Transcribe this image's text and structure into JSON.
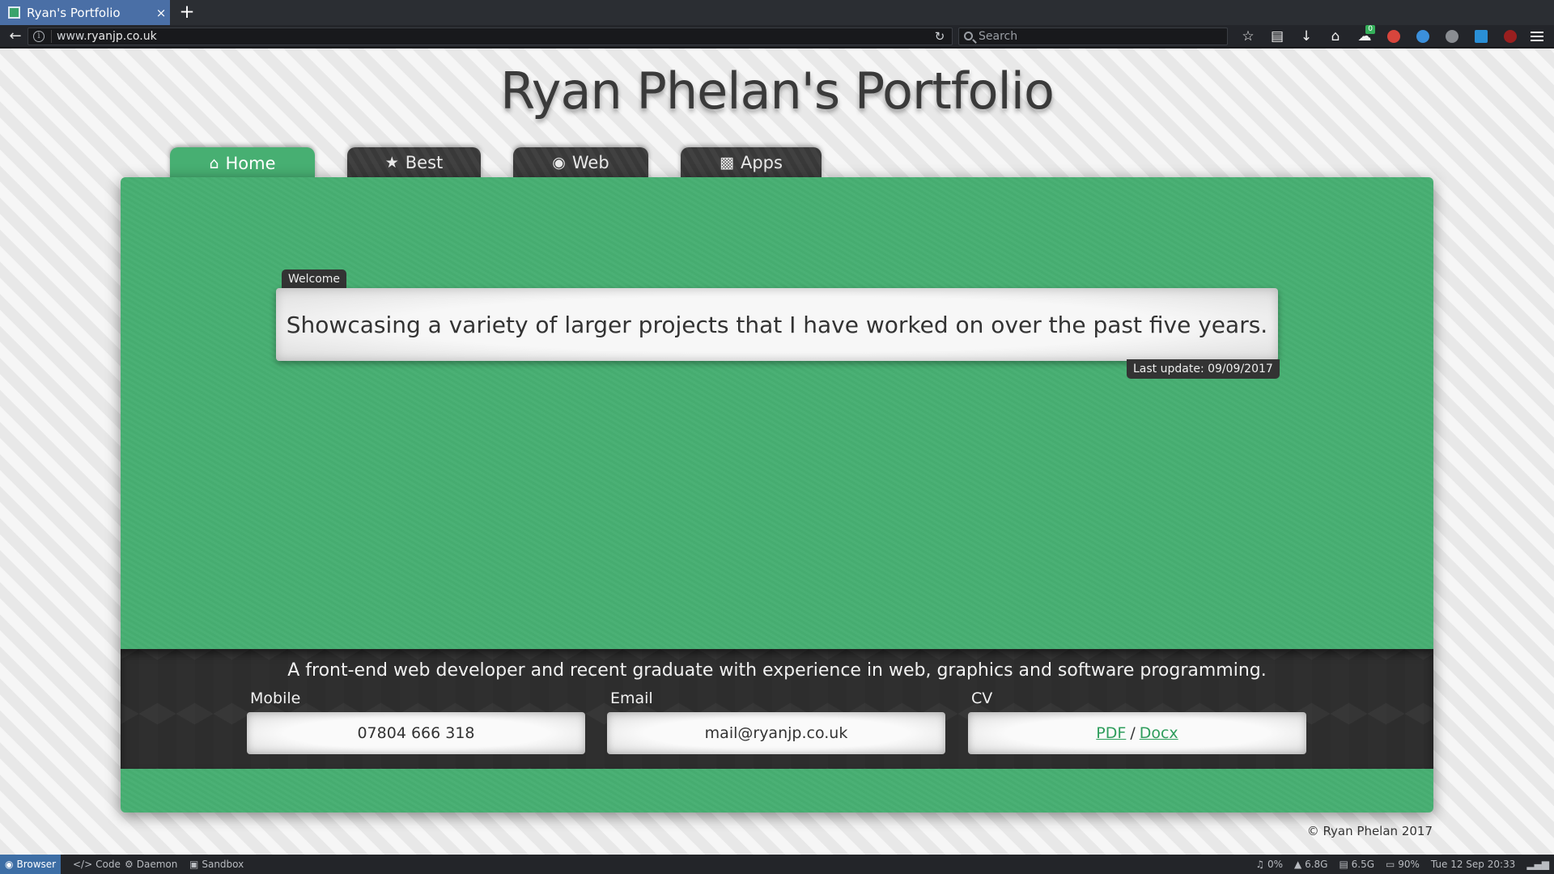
{
  "browser": {
    "tab_title": "Ryan's Portfolio",
    "tab_close": "×",
    "new_tab": "+",
    "url_prefix": "www.",
    "url_host": "ryanjp.co.uk",
    "search_placeholder": "Search",
    "addon_badge": "0",
    "accent": "#4a6fa6"
  },
  "site": {
    "title": "Ryan Phelan's Portfolio",
    "tabs": [
      {
        "label": "Home",
        "icon": "home-icon",
        "active": true
      },
      {
        "label": "Best",
        "icon": "star-icon",
        "active": false
      },
      {
        "label": "Web",
        "icon": "firefox-icon",
        "active": false
      },
      {
        "label": "Apps",
        "icon": "gamepad-icon",
        "active": false
      }
    ],
    "welcome_label": "Welcome",
    "welcome_text": "Showcasing a variety of larger projects that I have worked on over the past five years.",
    "last_update": "Last update: 09/09/2017",
    "tagline": "A front-end web developer and recent graduate with experience in web, graphics and software programming.",
    "contacts": {
      "mobile_label": "Mobile",
      "mobile_value": "07804 666 318",
      "email_label": "Email",
      "email_value": "mail@ryanjp.co.uk",
      "cv_label": "CV",
      "cv_pdf": "PDF",
      "cv_sep": "/",
      "cv_docx": "Docx"
    },
    "copyright": "© Ryan Phelan 2017",
    "colors": {
      "panel_green": "#47af72",
      "dark_tab": "#3b3b3b",
      "link_green": "#2e9d5c"
    }
  },
  "taskbar": {
    "items": [
      "Browser",
      "Code",
      "Daemon",
      "Sandbox"
    ],
    "volume": "0%",
    "memory": "6.8G",
    "disk": "6.5G",
    "battery": "90%",
    "clock": "Tue 12 Sep 20:33"
  }
}
